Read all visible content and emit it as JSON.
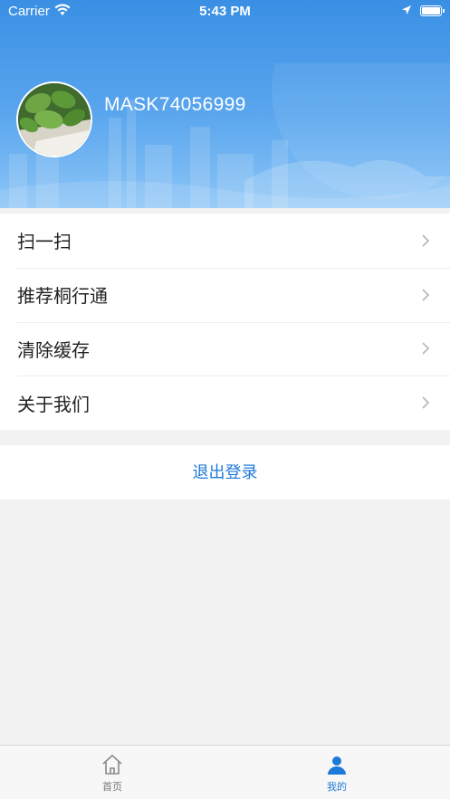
{
  "status_bar": {
    "carrier": "Carrier",
    "time": "5:43 PM"
  },
  "profile": {
    "username": "MASK74056999"
  },
  "menu": {
    "items": [
      {
        "label": "扫一扫"
      },
      {
        "label": "推荐桐行通"
      },
      {
        "label": "清除缓存"
      },
      {
        "label": "关于我们"
      }
    ]
  },
  "logout_label": "退出登录",
  "tabbar": {
    "tabs": [
      {
        "label": "首页",
        "icon": "home-icon",
        "active": false
      },
      {
        "label": "我的",
        "icon": "user-icon",
        "active": true
      }
    ]
  },
  "colors": {
    "accent": "#1e7ad8",
    "header": "#3a8fe4",
    "background": "#f2f2f2"
  }
}
